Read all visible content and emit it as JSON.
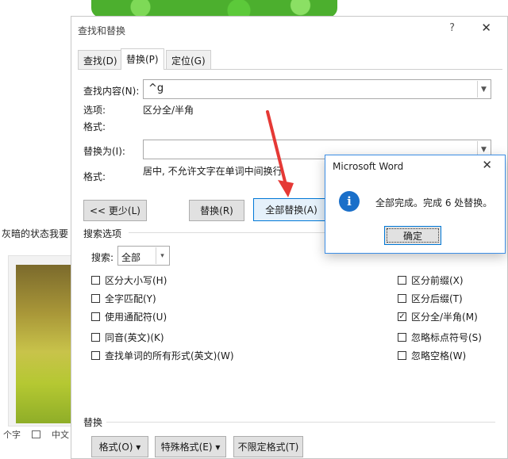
{
  "background": {
    "text_fragment": "灰暗的状态我要",
    "status_bar": {
      "item1": "个字",
      "item2": "中文"
    }
  },
  "dialog": {
    "title": "查找和替换",
    "help": "?",
    "close": "✕",
    "tabs": [
      "查找(D)",
      "替换(P)",
      "定位(G)"
    ],
    "active_tab": "替换(P)",
    "find_label": "查找内容(N):",
    "find_value": "^g",
    "options_label": "选项:",
    "options_value": "区分全/半角",
    "find_format_label": "格式:",
    "replace_label": "替换为(I):",
    "replace_value": "",
    "replace_format_label": "格式:",
    "replace_format_value": "居中, 不允许文字在单词中间换行",
    "buttons": {
      "less": "<< 更少(L)",
      "replace": "替换(R)",
      "replace_all": "全部替换(A)"
    },
    "search_options_title": "搜索选项",
    "search_label": "搜索:",
    "search_value": "全部",
    "left_options": [
      {
        "label": "区分大小写(H)",
        "checked": false
      },
      {
        "label": "全字匹配(Y)",
        "checked": false
      },
      {
        "label": "使用通配符(U)",
        "checked": false
      },
      {
        "label": "同音(英文)(K)",
        "checked": false
      },
      {
        "label": "查找单词的所有形式(英文)(W)",
        "checked": false
      }
    ],
    "right_options": [
      {
        "label": "区分前缀(X)",
        "checked": false
      },
      {
        "label": "区分后缀(T)",
        "checked": false
      },
      {
        "label": "区分全/半角(M)",
        "checked": true
      },
      {
        "label": "忽略标点符号(S)",
        "checked": false
      },
      {
        "label": "忽略空格(W)",
        "checked": false
      }
    ],
    "replace_section_title": "替换",
    "bottom_buttons": {
      "format": "格式(O) ▾",
      "special": "特殊格式(E) ▾",
      "no_format": "不限定格式(T)"
    }
  },
  "messagebox": {
    "title": "Microsoft Word",
    "close": "✕",
    "icon": "info-icon",
    "icon_glyph": "i",
    "message": "全部完成。完成 6 处替换。",
    "ok": "确定"
  },
  "colors": {
    "accent": "#0078d7",
    "info_icon": "#1a6fc9",
    "arrow": "#e53935"
  }
}
